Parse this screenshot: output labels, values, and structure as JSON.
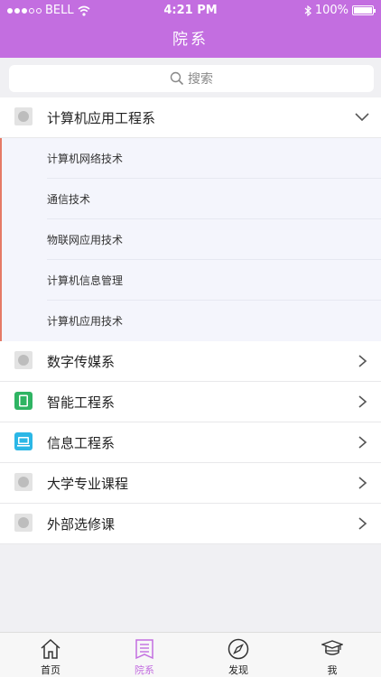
{
  "status_bar": {
    "carrier": "BELL",
    "time": "4:21 PM",
    "battery": "100%",
    "battery_level": 1.0
  },
  "nav": {
    "title": "院系"
  },
  "search": {
    "placeholder": "搜索"
  },
  "departments": [
    {
      "label": "计算机应用工程系",
      "icon": "gray-circle-icon",
      "expanded": true,
      "majors": [
        "计算机网络技术",
        "通信技术",
        "物联网应用技术",
        "计算机信息管理",
        "计算机应用技术"
      ]
    },
    {
      "label": "数字传媒系",
      "icon": "gray-circle-icon"
    },
    {
      "label": "智能工程系",
      "icon": "green-tablet-icon"
    },
    {
      "label": "信息工程系",
      "icon": "blue-laptop-icon"
    },
    {
      "label": "大学专业课程",
      "icon": "gray-circle-icon"
    },
    {
      "label": "外部选修课",
      "icon": "gray-circle-icon"
    }
  ],
  "tabs": [
    {
      "label": "首页",
      "icon": "home-icon"
    },
    {
      "label": "院系",
      "icon": "bookmark-list-icon",
      "active": true
    },
    {
      "label": "发现",
      "icon": "compass-icon"
    },
    {
      "label": "我",
      "icon": "graduation-cap-icon"
    }
  ],
  "colors": {
    "accent": "#c36ee0",
    "sub_bg": "#f4f5fc",
    "indicator": "#e57a66"
  }
}
